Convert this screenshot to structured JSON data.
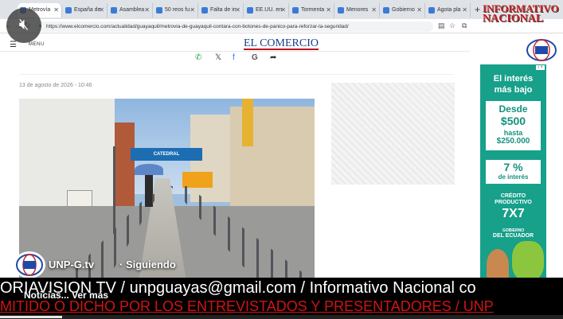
{
  "tabs": [
    {
      "label": "Metrovía",
      "active": true
    },
    {
      "label": "España de",
      "active": false
    },
    {
      "label": "Asamblea",
      "active": false
    },
    {
      "label": "50 reos fu",
      "active": false
    },
    {
      "label": "Falta de in",
      "active": false
    },
    {
      "label": "EE.UU. en",
      "active": false
    },
    {
      "label": "Tormenta",
      "active": false
    },
    {
      "label": "Menores",
      "active": false
    },
    {
      "label": "Gobierno",
      "active": false
    },
    {
      "label": "Agota pla",
      "active": false
    }
  ],
  "new_tab_label": "+",
  "address": {
    "url": "https://www.elcomercio.com/actualidad/guayaquil/metrovia-de-guayaquil-contara-con-botones-de-panico-para-reforzar-la-seguridad/"
  },
  "site": {
    "menu_label": "MENU",
    "logo": "EL COMERCIO",
    "share": {
      "whatsapp": "✆",
      "x": "𝕏",
      "facebook": "f",
      "google": "G",
      "share": "➦"
    },
    "date": "13 de agosto de 2026 - 10:46"
  },
  "ad_banner": {
    "chip": "i ×",
    "line1": "El interés",
    "line2": "más bajo",
    "desde_label": "Desde",
    "desde_amount": "$500",
    "hasta_label": "hasta",
    "hasta_amount": "$250.000",
    "rate": "7 %",
    "rate_label": "de interés",
    "product_line1": "CRÉDITO",
    "product_line2": "PRODUCTIVO",
    "product_code": "7X7",
    "gov_line1": "GOBIERNO",
    "gov_line2": "DEL ECUADOR"
  },
  "photo": {
    "bus_stop_sign": "CATEDRAL"
  },
  "broadcaster": {
    "line1": "INFORMATIVO",
    "line2": "NACIONAL"
  },
  "channel": {
    "name": "UNP-G.tv",
    "follow": "· Siguiendo"
  },
  "ticker_top": "ORIAVISION TV / unpguayas@gmail.com / Informativo Nacional co",
  "ticker_bottom": "MITIDO O DICHO POR LOS ENTREVISTADOS Y PRESENTADORES / UNP",
  "news_label": "Noticias... Ver más",
  "video": {
    "progress_fraction": 0.11
  },
  "colors": {
    "brand_blue": "#1a3f8c",
    "brand_red": "#c0161b",
    "banner_green": "#17a08a",
    "ticker_red": "#d21313"
  },
  "icons": {
    "mute": "🔇︎"
  }
}
